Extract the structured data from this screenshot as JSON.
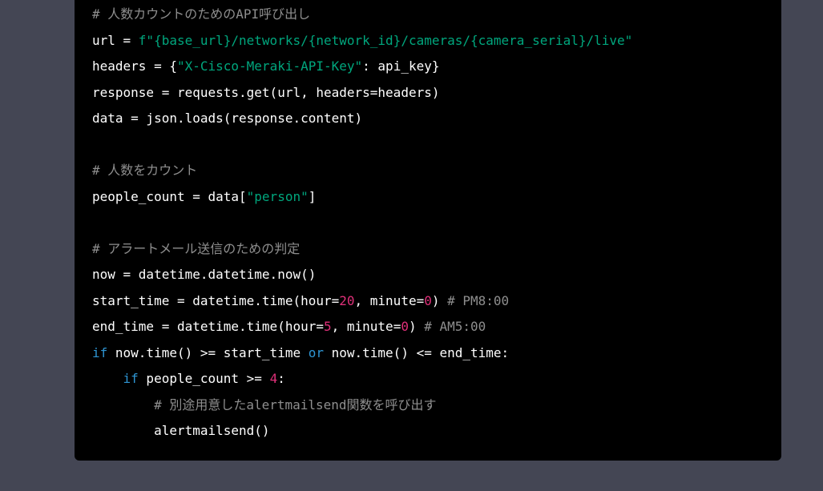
{
  "theme": {
    "page_background": "#444654",
    "code_background": "#000000",
    "colors": {
      "plain": "#ffffff",
      "comment": "#8e8e8e",
      "string": "#00a67d",
      "number": "#df3079",
      "keyword": "#2e95d3"
    }
  },
  "code": {
    "lines": [
      [
        {
          "t": "comment",
          "v": "# 人数カウントのためのAPI呼び出し"
        }
      ],
      [
        {
          "t": "plain",
          "v": "url = "
        },
        {
          "t": "string",
          "v": "f\"{base_url}/networks/{network_id}/cameras/{camera_serial}/live\""
        }
      ],
      [
        {
          "t": "plain",
          "v": "headers = {"
        },
        {
          "t": "string",
          "v": "\"X-Cisco-Meraki-API-Key\""
        },
        {
          "t": "plain",
          "v": ": api_key}"
        }
      ],
      [
        {
          "t": "plain",
          "v": "response = requests.get(url, headers=headers)"
        }
      ],
      [
        {
          "t": "plain",
          "v": "data = json.loads(response.content)"
        }
      ],
      [],
      [
        {
          "t": "comment",
          "v": "# 人数をカウント"
        }
      ],
      [
        {
          "t": "plain",
          "v": "people_count = data["
        },
        {
          "t": "string",
          "v": "\"person\""
        },
        {
          "t": "plain",
          "v": "]"
        }
      ],
      [],
      [
        {
          "t": "comment",
          "v": "# アラートメール送信のための判定"
        }
      ],
      [
        {
          "t": "plain",
          "v": "now = datetime.datetime.now()"
        }
      ],
      [
        {
          "t": "plain",
          "v": "start_time = datetime.time(hour="
        },
        {
          "t": "number",
          "v": "20"
        },
        {
          "t": "plain",
          "v": ", minute="
        },
        {
          "t": "number",
          "v": "0"
        },
        {
          "t": "plain",
          "v": ") "
        },
        {
          "t": "comment",
          "v": "# PM8:00"
        }
      ],
      [
        {
          "t": "plain",
          "v": "end_time = datetime.time(hour="
        },
        {
          "t": "number",
          "v": "5"
        },
        {
          "t": "plain",
          "v": ", minute="
        },
        {
          "t": "number",
          "v": "0"
        },
        {
          "t": "plain",
          "v": ") "
        },
        {
          "t": "comment",
          "v": "# AM5:00"
        }
      ],
      [
        {
          "t": "keyword",
          "v": "if"
        },
        {
          "t": "plain",
          "v": " now.time() >= start_time "
        },
        {
          "t": "keyword",
          "v": "or"
        },
        {
          "t": "plain",
          "v": " now.time() <= end_time:"
        }
      ],
      [
        {
          "t": "plain",
          "v": "    "
        },
        {
          "t": "keyword",
          "v": "if"
        },
        {
          "t": "plain",
          "v": " people_count >= "
        },
        {
          "t": "number",
          "v": "4"
        },
        {
          "t": "plain",
          "v": ":"
        }
      ],
      [
        {
          "t": "plain",
          "v": "        "
        },
        {
          "t": "comment",
          "v": "# 別途用意したalertmailsend関数を呼び出す"
        }
      ],
      [
        {
          "t": "plain",
          "v": "        alertmailsend()"
        }
      ]
    ]
  }
}
